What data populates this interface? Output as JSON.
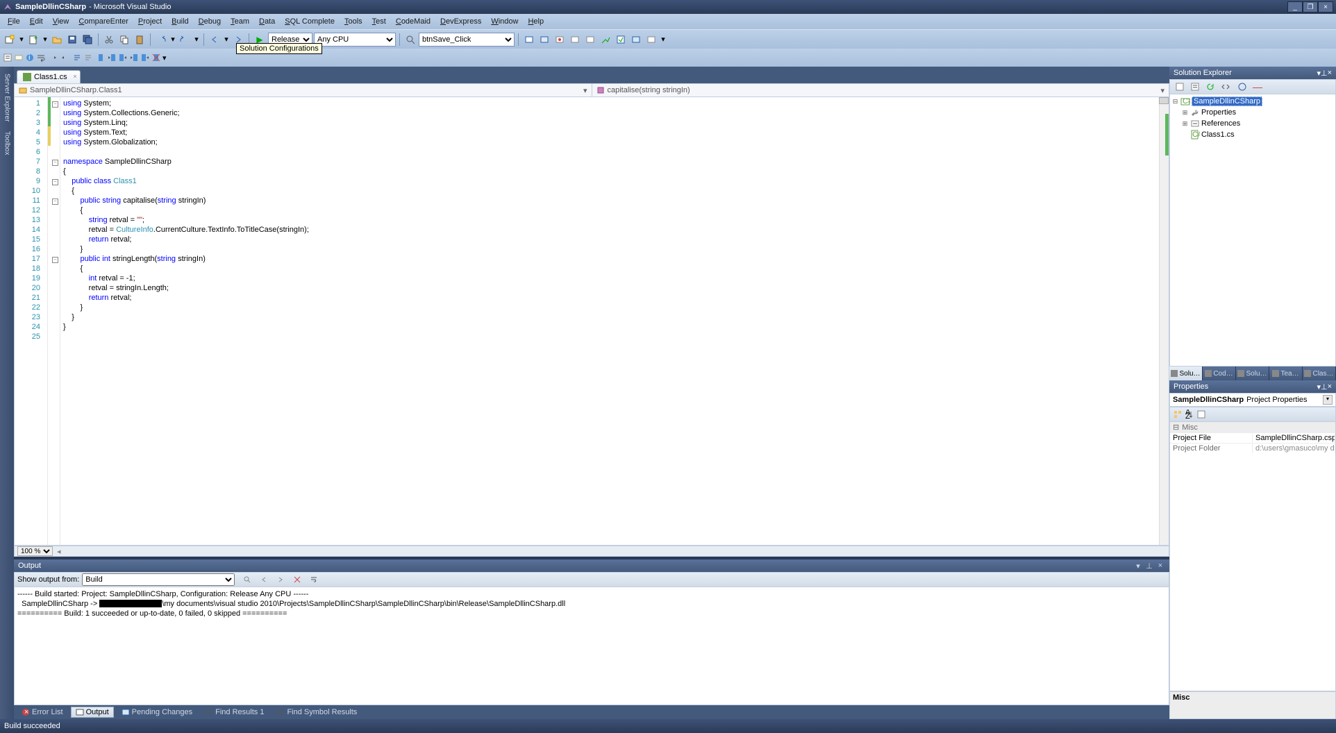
{
  "title": {
    "main": "SampleDllinCSharp",
    "suffix": " - Microsoft Visual Studio"
  },
  "menus": [
    "File",
    "Edit",
    "View",
    "CompareEnter",
    "Project",
    "Build",
    "Debug",
    "Team",
    "Data",
    "SQL Complete",
    "Tools",
    "Test",
    "CodeMaid",
    "DevExpress",
    "Window",
    "Help"
  ],
  "toolbar": {
    "config": "Release",
    "platform": "Any CPU",
    "event": "btnSave_Click"
  },
  "tooltip": "Solution Configurations",
  "leftdock": [
    "Server Explorer",
    "Toolbox"
  ],
  "doctab": {
    "name": "Class1.cs"
  },
  "nav": {
    "left": "SampleDllinCSharp.Class1",
    "right": "capitalise(string stringIn)"
  },
  "code": {
    "lines": [
      {
        "n": 1,
        "fold": "box",
        "chg": "g",
        "html": "<span class='kw'>using</span> System;"
      },
      {
        "n": 2,
        "fold": "",
        "chg": "g",
        "html": "<span class='kw'>using</span> System.Collections.Generic;"
      },
      {
        "n": 3,
        "fold": "",
        "chg": "g",
        "html": "<span class='kw'>using</span> System.Linq;"
      },
      {
        "n": 4,
        "fold": "",
        "chg": "y",
        "html": "<span class='kw'>using</span> System.Text;"
      },
      {
        "n": 5,
        "fold": "",
        "chg": "y",
        "html": "<span class='kw'>using</span> System.Globalization;"
      },
      {
        "n": 6,
        "fold": "",
        "chg": "",
        "html": ""
      },
      {
        "n": 7,
        "fold": "box",
        "chg": "",
        "html": "<span class='kw'>namespace</span> SampleDllinCSharp"
      },
      {
        "n": 8,
        "fold": "",
        "chg": "",
        "html": "{"
      },
      {
        "n": 9,
        "fold": "box",
        "chg": "",
        "html": "    <span class='kw'>public</span> <span class='kw'>class</span> <span class='typ'>Class1</span>"
      },
      {
        "n": 10,
        "fold": "",
        "chg": "",
        "html": "    {"
      },
      {
        "n": 11,
        "fold": "box",
        "chg": "",
        "html": "        <span class='kw'>public</span> <span class='kw'>string</span> capitalise(<span class='kw'>string</span> stringIn)"
      },
      {
        "n": 12,
        "fold": "",
        "chg": "",
        "html": "        {"
      },
      {
        "n": 13,
        "fold": "",
        "chg": "",
        "html": "            <span class='kw'>string</span> retval = <span class='str'>\"\"</span>;"
      },
      {
        "n": 14,
        "fold": "",
        "chg": "",
        "html": "            retval = <span class='typ'>CultureInfo</span>.CurrentCulture.TextInfo.ToTitleCase(stringIn);"
      },
      {
        "n": 15,
        "fold": "",
        "chg": "",
        "html": "            <span class='kw'>return</span> retval;"
      },
      {
        "n": 16,
        "fold": "",
        "chg": "",
        "html": "        }"
      },
      {
        "n": 17,
        "fold": "box",
        "chg": "",
        "html": "        <span class='kw'>public</span> <span class='kw'>int</span> stringLength(<span class='kw'>string</span> stringIn)"
      },
      {
        "n": 18,
        "fold": "",
        "chg": "",
        "html": "        {"
      },
      {
        "n": 19,
        "fold": "",
        "chg": "",
        "html": "            <span class='kw'>int</span> retval = -1;"
      },
      {
        "n": 20,
        "fold": "",
        "chg": "",
        "html": "            retval = stringIn.Length;"
      },
      {
        "n": 21,
        "fold": "",
        "chg": "",
        "html": "            <span class='kw'>return</span> retval;"
      },
      {
        "n": 22,
        "fold": "",
        "chg": "",
        "html": "        }"
      },
      {
        "n": 23,
        "fold": "",
        "chg": "",
        "html": "    }"
      },
      {
        "n": 24,
        "fold": "",
        "chg": "",
        "html": "}"
      },
      {
        "n": 25,
        "fold": "",
        "chg": "",
        "html": ""
      }
    ]
  },
  "zoom": "100 %",
  "output": {
    "title": "Output",
    "label": "Show output from:",
    "source": "Build",
    "text_pre": "------ Build started: Project: SampleDllinCSharp, Configuration: Release Any CPU ------\n  SampleDllinCSharp -> ",
    "text_post": "\\my documents\\visual studio 2010\\Projects\\SampleDllinCSharp\\SampleDllinCSharp\\bin\\Release\\SampleDllinCSharp.dll\n========== Build: 1 succeeded or up-to-date, 0 failed, 0 skipped =========="
  },
  "bottomtabs": [
    "Error List",
    "Output",
    "Pending Changes",
    "Find Results 1",
    "Find Symbol Results"
  ],
  "solution": {
    "title": "Solution Explorer",
    "root": "SampleDllinCSharp",
    "children": [
      "Properties",
      "References",
      "Class1.cs"
    ]
  },
  "righttabs": [
    "Solu…",
    "Cod…",
    "Solu…",
    "Tea…",
    "Clas…"
  ],
  "props": {
    "title": "Properties",
    "obj": "SampleDllinCSharp",
    "objType": "Project Properties",
    "cat": "Misc",
    "rows": [
      {
        "k": "Project File",
        "v": "SampleDllinCSharp.csproj",
        "active": true
      },
      {
        "k": "Project Folder",
        "v": "d:\\users\\gmasuco\\my documen",
        "active": false
      }
    ],
    "desc": "Misc"
  },
  "status": "Build succeeded"
}
